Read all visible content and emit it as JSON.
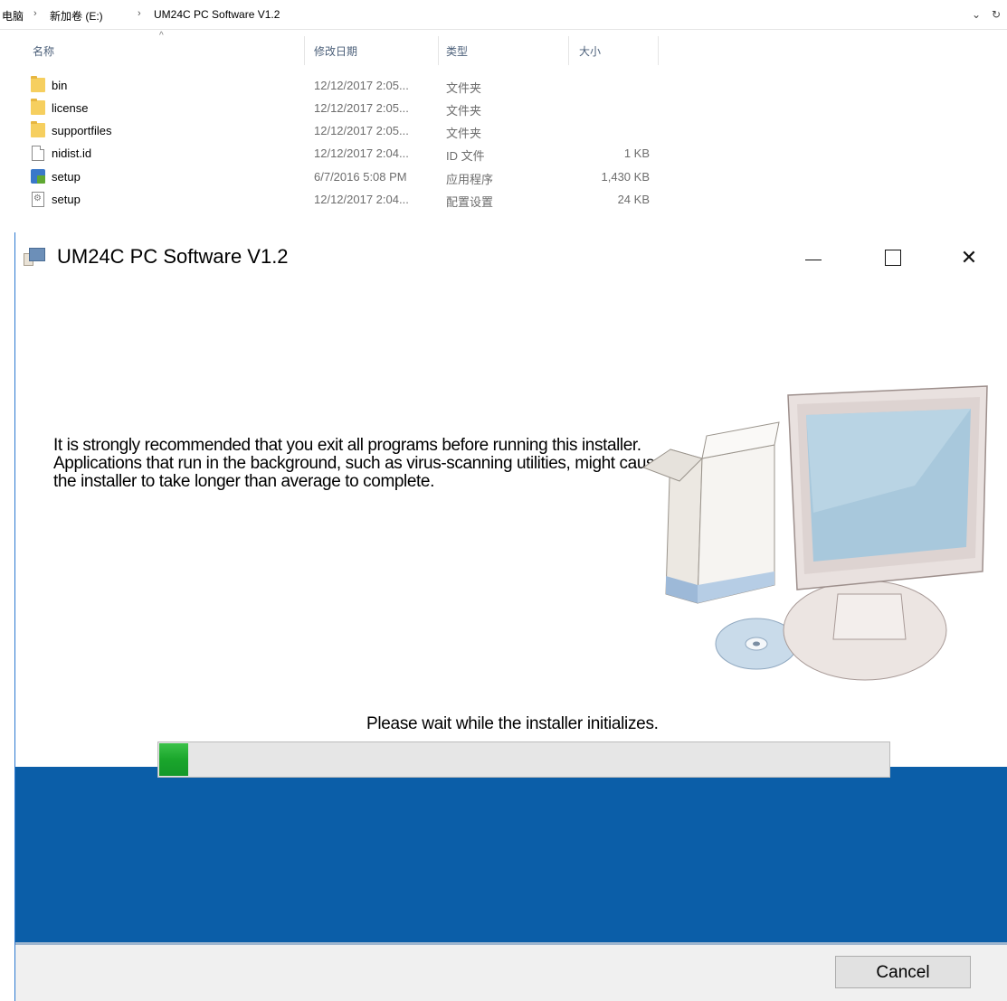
{
  "explorer": {
    "breadcrumb": [
      "电脑",
      "新加卷 (E:)",
      "UM24C PC Software V1.2"
    ],
    "breadcrumb_separator": "›",
    "address_dropdown": "⌄",
    "address_refresh": "↻",
    "sort_indicator": "^",
    "columns": {
      "name": "名称",
      "date": "修改日期",
      "type": "类型",
      "size": "大小"
    },
    "files": [
      {
        "name": "bin",
        "date": "12/12/2017 2:05...",
        "type": "文件夹",
        "size": "",
        "icon": "folder-icon"
      },
      {
        "name": "license",
        "date": "12/12/2017 2:05...",
        "type": "文件夹",
        "size": "",
        "icon": "folder-icon"
      },
      {
        "name": "supportfiles",
        "date": "12/12/2017 2:05...",
        "type": "文件夹",
        "size": "",
        "icon": "folder-icon"
      },
      {
        "name": "nidist.id",
        "date": "12/12/2017 2:04...",
        "type": "ID 文件",
        "size": "1 KB",
        "icon": "file-icon"
      },
      {
        "name": "setup",
        "date": "6/7/2016 5:08 PM",
        "type": "应用程序",
        "size": "1,430 KB",
        "icon": "setup-app-icon"
      },
      {
        "name": "setup",
        "date": "12/12/2017 2:04...",
        "type": "配置设置",
        "size": "24 KB",
        "icon": "config-file-icon"
      }
    ]
  },
  "installer": {
    "title": "UM24C PC Software V1.2",
    "close_glyph": "✕",
    "recommendation": "It is strongly recommended that you exit all programs before running this installer. Applications that run in the background, such as virus-scanning utilities, might cause the installer to take longer than average to complete.",
    "status": "Please wait while the installer initializes.",
    "progress_fraction": 0.04,
    "cancel_label": "Cancel",
    "colors": {
      "band": "#0b5ea8",
      "progress_fill": "#1aa62b",
      "window_border": "#2b78d0"
    }
  }
}
